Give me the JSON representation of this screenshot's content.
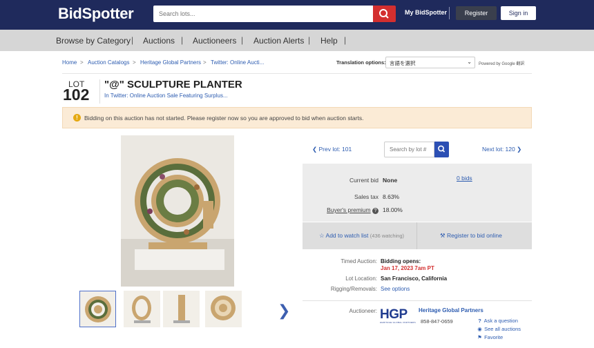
{
  "header": {
    "logo": "BidSpotter",
    "search_placeholder": "Search lots...",
    "my_bidspotter": "My BidSpotter",
    "register": "Register",
    "sign_in": "Sign in"
  },
  "nav": {
    "items": [
      "Browse by Category",
      "Auctions",
      "Auctioneers",
      "Auction Alerts",
      "Help"
    ],
    "separator": "|"
  },
  "breadcrumb": {
    "items": [
      "Home",
      "Auction Catalogs",
      "Heritage Global Partners",
      "Twitter: Online Aucti..."
    ],
    "separator": ">"
  },
  "translation": {
    "label": "Translation options:",
    "selected": "言語を選択",
    "powered_by": "Powered by Google 翻訳"
  },
  "lot": {
    "lot_word": "LOT",
    "number": "102",
    "title": "\"@\" SCULPTURE PLANTER",
    "in_auction": "In Twitter: Online Auction Sale Featuring Surplus..."
  },
  "notice": {
    "text": "Bidding on this auction has not started. Please register now so you are approved to bid when auction starts."
  },
  "lot_nav": {
    "prev": "Prev lot: 101",
    "search_placeholder": "Search by lot #",
    "next": "Next lot: 120"
  },
  "bid": {
    "current_bid_label": "Current bid",
    "current_bid_value": "None",
    "bids_link": "0 bids",
    "sales_tax_label": "Sales tax",
    "sales_tax_value": "8.63%",
    "buyers_premium_label": "Buyer's premium",
    "buyers_premium_value": "18.00%"
  },
  "actions": {
    "watch": "Add to watch list",
    "watching": "(436 watching)",
    "register_online": "Register to bid online"
  },
  "details": {
    "timed_label": "Timed Auction:",
    "bidding_opens": "Bidding opens:",
    "opens_date": "Jan 17, 2023 7am PT",
    "location_label": "Lot Location:",
    "location_value": "San Francisco, California",
    "rigging_label": "Rigging/Removals:",
    "rigging_value": "See options"
  },
  "auctioneer": {
    "label": "Auctioneer:",
    "logo_text": "HGP",
    "logo_subtext": "HERITAGE GLOBAL PARTNERS",
    "name": "Heritage Global Partners",
    "phone": "858-847-0659",
    "ask_question": "Ask a question",
    "see_all": "See all auctions",
    "favorite": "Favorite"
  },
  "colors": {
    "header_bg": "#1f2a5c",
    "nav_bg": "#d6d6d6",
    "search_btn": "#d32f2f",
    "link": "#2d5cb0",
    "notice_bg": "#fbebd6",
    "alert_red": "#d32f2f"
  }
}
